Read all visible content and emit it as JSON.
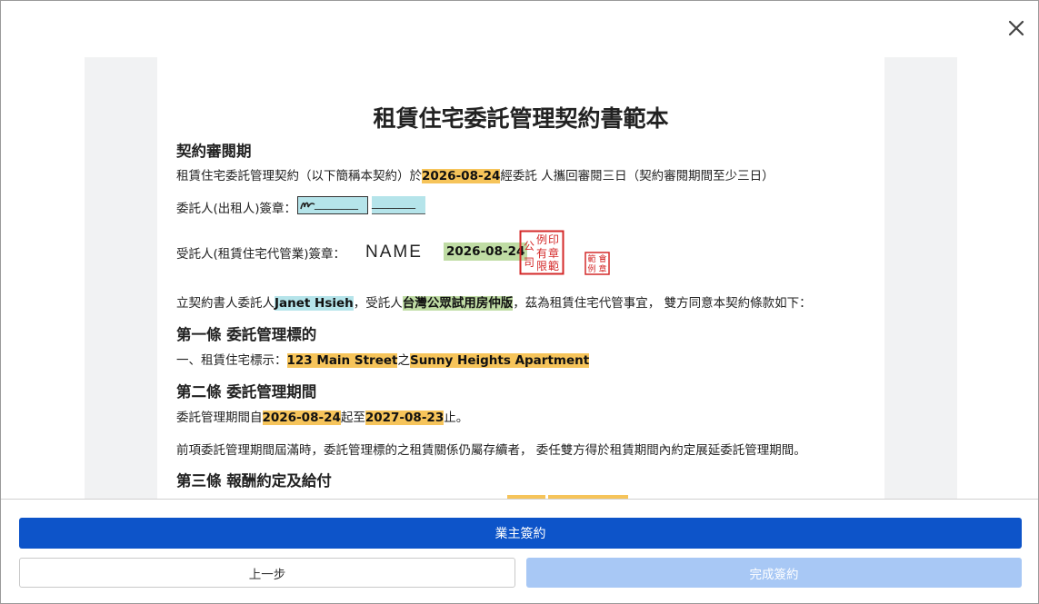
{
  "dialog": {
    "close_label": "×"
  },
  "document": {
    "title": "租賃住宅委託管理契約書範本",
    "review": {
      "heading": "契約審閱期",
      "text_before": "租賃住宅委託管理契約（以下簡稱本契約）於",
      "date": "2026-08-24",
      "text_after": "經委託 人攜回審閱三日（契約審閱期間至少三日）"
    },
    "principal_sign": {
      "label": "委託人(出租人)簽章：",
      "blank1": "________",
      "blank2": "________"
    },
    "agent_sign": {
      "label": "受託人(租賃住宅代管業)簽章：",
      "name_signature": "NAME",
      "date": "2026-08-24",
      "seal_big_text": [
        "印",
        "例",
        "公",
        "章",
        "有",
        "司",
        "範",
        "限"
      ],
      "seal_small_text": [
        "會",
        "範",
        "章",
        "例"
      ]
    },
    "intro": {
      "text1": "立契約書人委託人",
      "principal_name": "Janet Hsieh",
      "text2": "，受託人",
      "agent_name": "台灣公眾試用房仲版",
      "text3": "，茲為租賃住宅代管事宜， 雙方同意本契約條款如下："
    },
    "article1": {
      "heading": "第一條 委託管理標的",
      "text1": "一、租賃住宅標示：",
      "address": "123 Main Street",
      "text2": "之",
      "building": "Sunny Heights Apartment"
    },
    "article2": {
      "heading": "第二條 委託管理期間",
      "text1": "委託管理期間自",
      "start_date": "2026-08-24",
      "text2": "起至",
      "end_date": "2027-08-23",
      "text3": "止。",
      "renewal_text": "前項委託管理期間屆滿時，委託管理標的之租賃關係仍屬存續者， 委任雙方得於租賃期間內約定展延委託管理期間。"
    },
    "article3": {
      "heading": "第三條 報酬約定及給付"
    }
  },
  "footer": {
    "owner_sign_label": "業主簽約",
    "prev_label": "上一步",
    "done_label": "完成簽約"
  },
  "colors": {
    "primary": "#0d54c9",
    "disabled": "#a8c8f5",
    "highlight_yellow": "#f6c45a",
    "highlight_cyan": "#b5e4ea",
    "highlight_green": "#bfdca4",
    "seal_red": "#d42a2a"
  }
}
